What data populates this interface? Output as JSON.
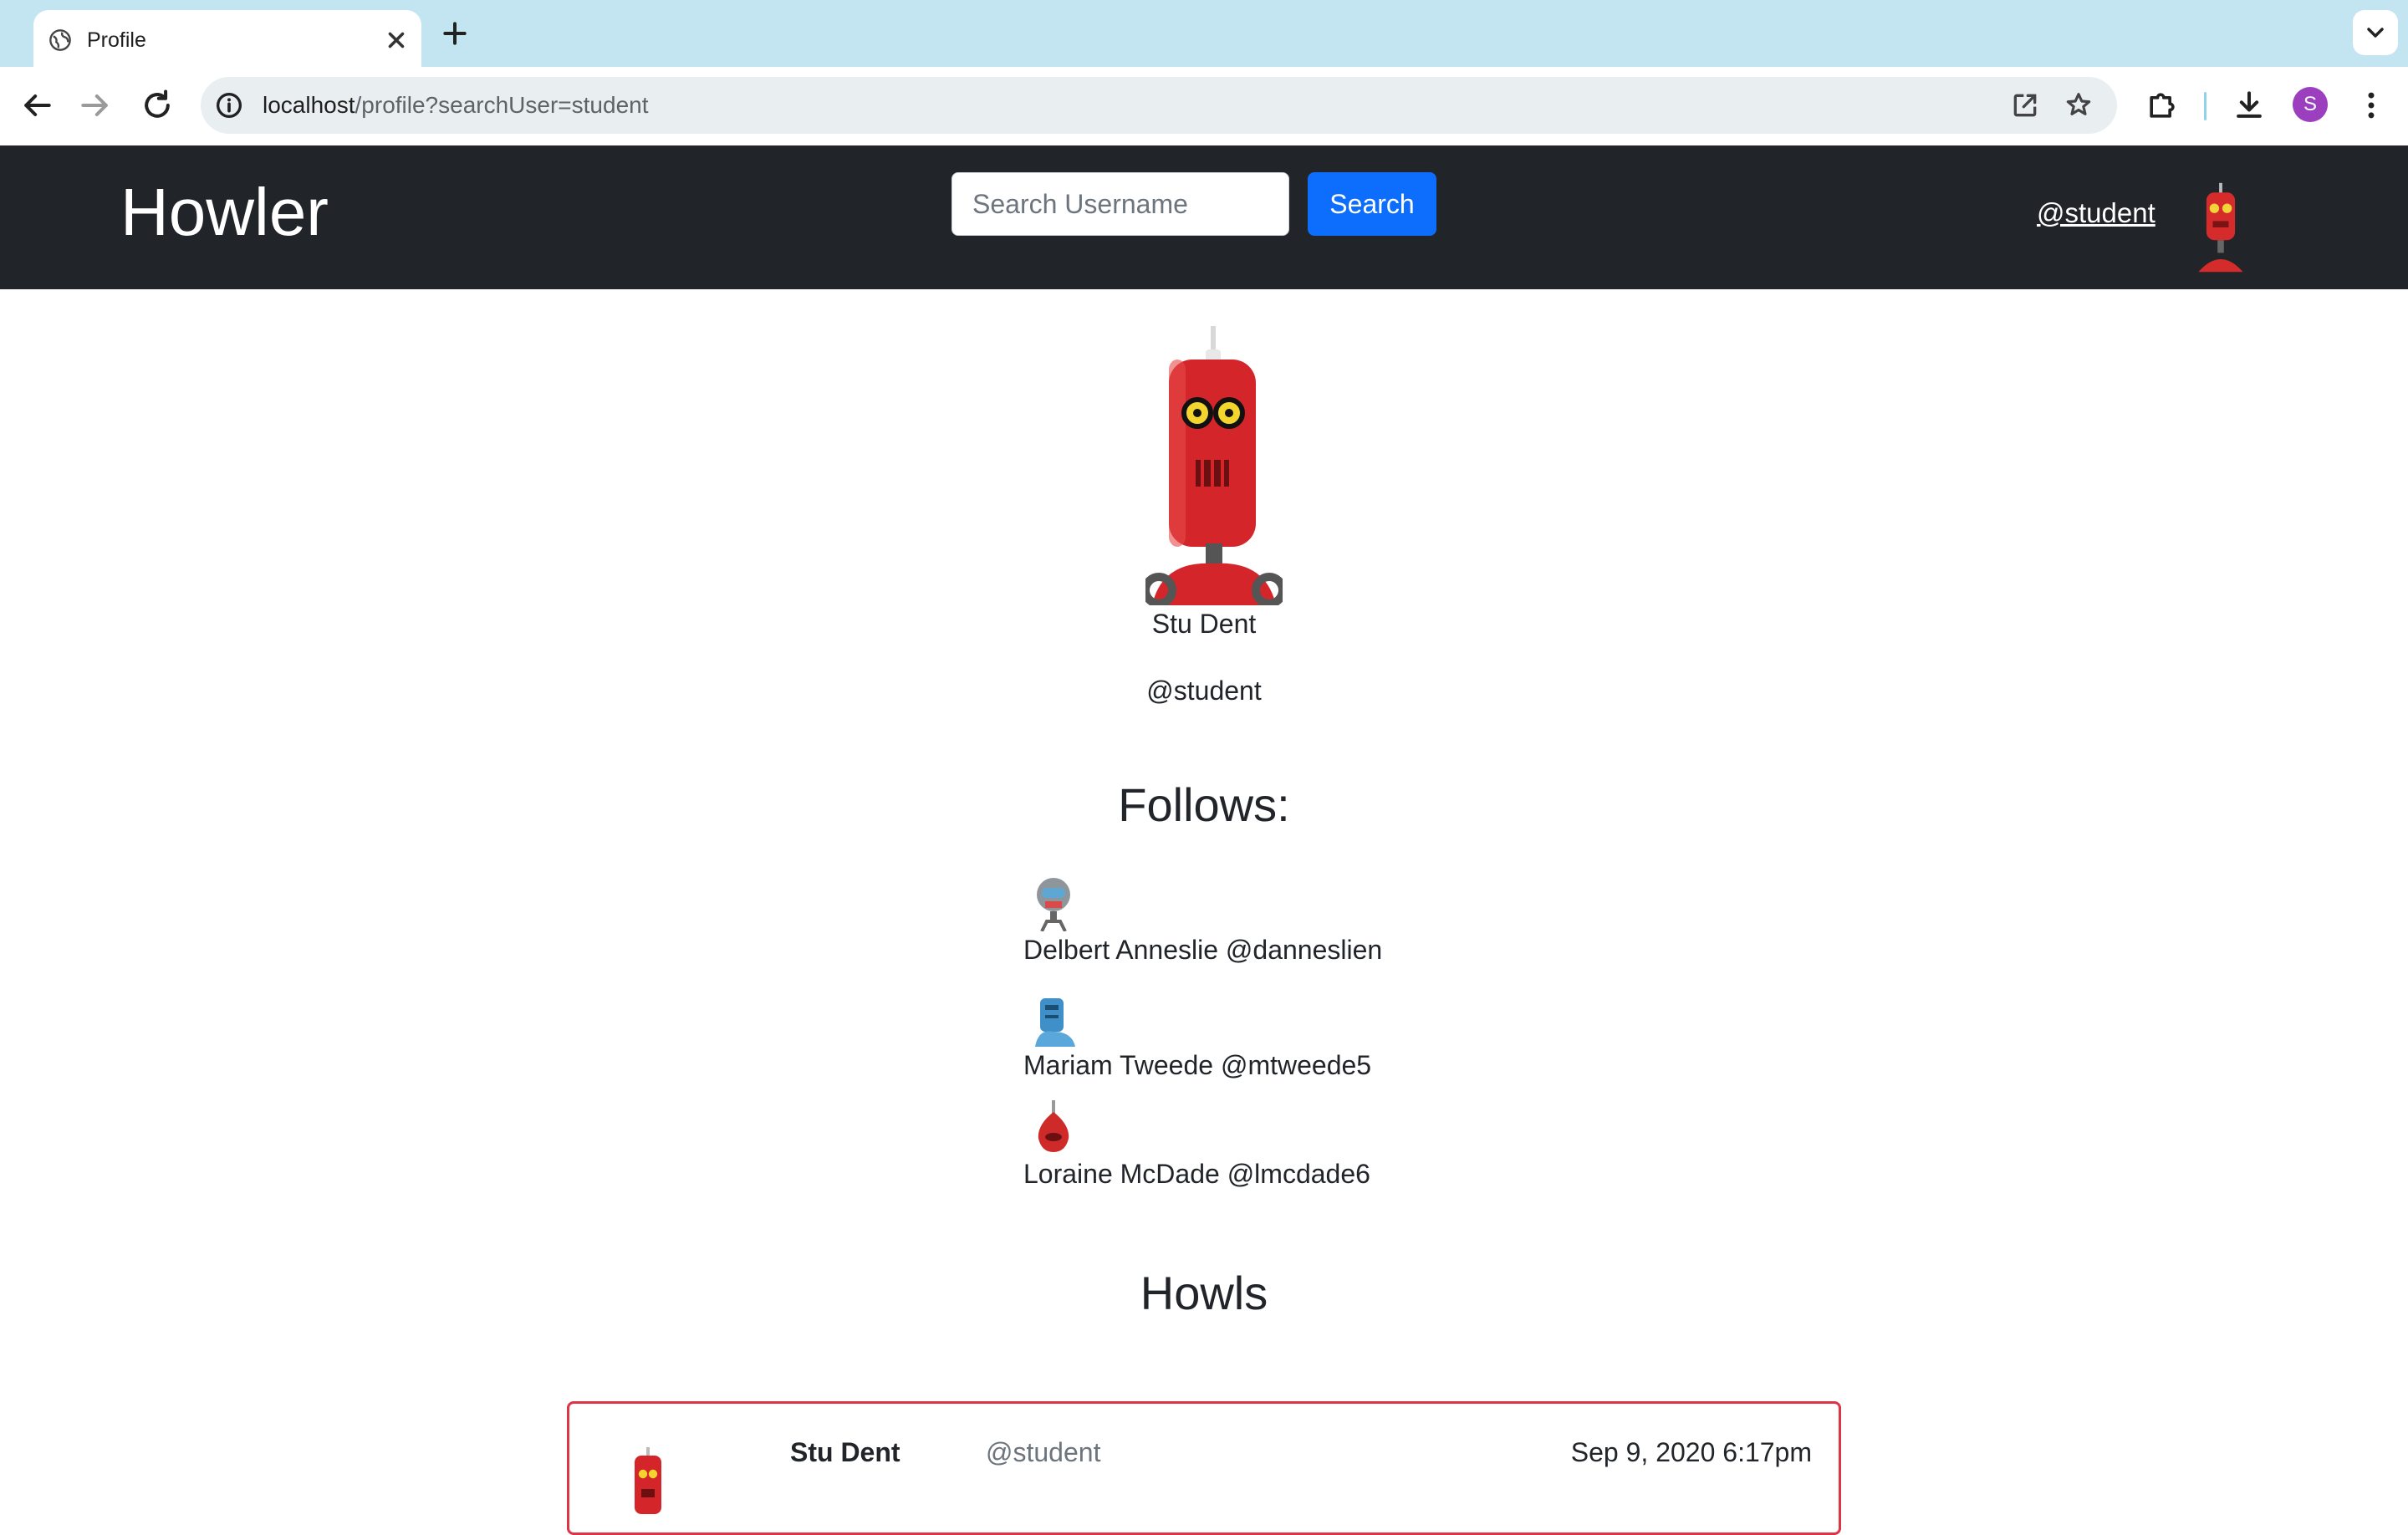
{
  "browser": {
    "tab_title": "Profile",
    "url_host": "localhost",
    "url_path": "/profile?searchUser=student",
    "profile_initial": "S"
  },
  "navbar": {
    "brand": "Howler",
    "search_placeholder": "Search Username",
    "search_button": "Search",
    "current_user": "@student"
  },
  "profile": {
    "name": "Stu Dent",
    "handle": "@student"
  },
  "follows": {
    "heading": "Follows:",
    "items": [
      {
        "label": "Delbert Anneslie @danneslien",
        "icon": "robot-grey-icon"
      },
      {
        "label": "Mariam Tweede @mtweede5",
        "icon": "robot-blue-icon"
      },
      {
        "label": "Loraine McDade @lmcdade6",
        "icon": "robot-red-icon"
      }
    ]
  },
  "howls": {
    "heading": "Howls",
    "items": [
      {
        "author": "Stu Dent",
        "handle": "@student",
        "date": "Sep 9, 2020 6:17pm"
      }
    ]
  },
  "colors": {
    "navbar_bg": "#212529",
    "primary": "#0d6efd",
    "howl_border": "#dc3545",
    "tabstrip": "#c3e5f2"
  }
}
